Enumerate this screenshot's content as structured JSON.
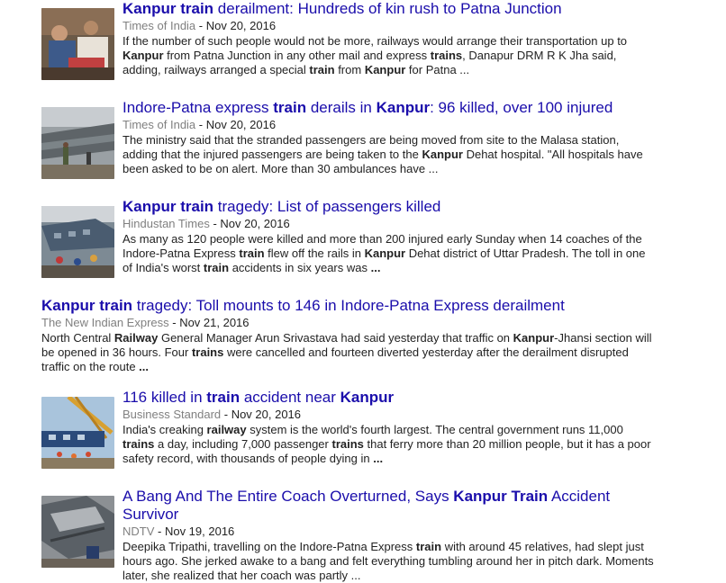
{
  "results": [
    {
      "title_parts": [
        {
          "t": "Kanpur train",
          "b": true
        },
        {
          "t": " derailment: Hundreds of kin rush to Patna Junction",
          "b": false
        }
      ],
      "source": "Times of India",
      "date": "Nov 20, 2016",
      "snippet_parts": [
        {
          "t": "If the number of such people would not be more, railways would arrange their transportation up to ",
          "b": false
        },
        {
          "t": "Kanpur",
          "b": true
        },
        {
          "t": " from Patna Junction in any other mail and express ",
          "b": false
        },
        {
          "t": "trains",
          "b": true
        },
        {
          "t": ", Danapur DRM R K Jha said, adding, railways arranged a special ",
          "b": false
        },
        {
          "t": "train",
          "b": true
        },
        {
          "t": " from ",
          "b": false
        },
        {
          "t": "Kanpur",
          "b": true
        },
        {
          "t": " for Patna ...",
          "b": false
        }
      ]
    },
    {
      "title_parts": [
        {
          "t": "Indore-Patna express ",
          "b": false
        },
        {
          "t": "train",
          "b": true
        },
        {
          "t": " derails in ",
          "b": false
        },
        {
          "t": "Kanpur",
          "b": true
        },
        {
          "t": ": 96 killed, over 100 injured",
          "b": false
        }
      ],
      "source": "Times of India",
      "date": "Nov 20, 2016",
      "snippet_parts": [
        {
          "t": "The ministry said that the stranded passengers are being moved from site to the Malasa station, adding that the injured passengers are being taken to the ",
          "b": false
        },
        {
          "t": "Kanpur",
          "b": true
        },
        {
          "t": " Dehat hospital. \"All hospitals have been asked to be on alert. More than 30 ambulances have ...",
          "b": false
        }
      ]
    },
    {
      "title_parts": [
        {
          "t": "Kanpur train",
          "b": true
        },
        {
          "t": " tragedy: List of passengers killed",
          "b": false
        }
      ],
      "source": "Hindustan Times",
      "date": "Nov 20, 2016",
      "snippet_parts": [
        {
          "t": "As many as 120 people were killed and more than 200 injured early Sunday when 14 coaches of the Indore-Patna Express ",
          "b": false
        },
        {
          "t": "train",
          "b": true
        },
        {
          "t": " flew off the rails in ",
          "b": false
        },
        {
          "t": "Kanpur",
          "b": true
        },
        {
          "t": " Dehat district of Uttar Pradesh. The toll in one of India's worst ",
          "b": false
        },
        {
          "t": "train",
          "b": true
        },
        {
          "t": " accidents in six years was ",
          "b": false
        },
        {
          "t": "...",
          "b": true
        }
      ]
    },
    {
      "title_parts": [
        {
          "t": "Kanpur train",
          "b": true
        },
        {
          "t": " tragedy: Toll mounts to 146 in Indore-Patna Express derailment",
          "b": false
        }
      ],
      "source": "The New Indian Express",
      "date": "Nov 21, 2016",
      "snippet_parts": [
        {
          "t": "North Central ",
          "b": false
        },
        {
          "t": "Railway",
          "b": true
        },
        {
          "t": " General Manager Arun Srivastava had said yesterday that traffic on ",
          "b": false
        },
        {
          "t": "Kanpur",
          "b": true
        },
        {
          "t": "-Jhansi section will be opened in 36 hours. Four ",
          "b": false
        },
        {
          "t": "trains",
          "b": true
        },
        {
          "t": " were cancelled and fourteen diverted yesterday after the derailment disrupted traffic on the route ",
          "b": false
        },
        {
          "t": "...",
          "b": true
        }
      ]
    },
    {
      "title_parts": [
        {
          "t": "116 killed in ",
          "b": false
        },
        {
          "t": "train",
          "b": true
        },
        {
          "t": " accident near ",
          "b": false
        },
        {
          "t": "Kanpur",
          "b": true
        }
      ],
      "source": "Business Standard",
      "date": "Nov 20, 2016",
      "snippet_parts": [
        {
          "t": "India's creaking ",
          "b": false
        },
        {
          "t": "railway",
          "b": true
        },
        {
          "t": " system is the world's fourth largest. The central government runs 11,000 ",
          "b": false
        },
        {
          "t": "trains",
          "b": true
        },
        {
          "t": " a day, including 7,000 passenger ",
          "b": false
        },
        {
          "t": "trains",
          "b": true
        },
        {
          "t": " that ferry more than 20 million people, but it has a poor safety record, with thousands of people dying in ",
          "b": false
        },
        {
          "t": "...",
          "b": true
        }
      ]
    },
    {
      "title_parts": [
        {
          "t": "A Bang And The Entire Coach Overturned, Says ",
          "b": false
        },
        {
          "t": "Kanpur Train",
          "b": true
        },
        {
          "t": " Accident Survivor",
          "b": false
        }
      ],
      "source": "NDTV",
      "date": "Nov 19, 2016",
      "snippet_parts": [
        {
          "t": "Deepika Tripathi, travelling on the Indore-Patna Express ",
          "b": false
        },
        {
          "t": "train",
          "b": true
        },
        {
          "t": " with around 45 relatives, had slept just hours ago. She jerked awake to a bang and felt everything tumbling around her in pitch dark. Moments later, she realized that her coach was partly ...",
          "b": false
        }
      ]
    }
  ],
  "separator": " - ",
  "colors": {
    "link": "#1a0dab",
    "source": "#808080",
    "text": "#222222"
  }
}
